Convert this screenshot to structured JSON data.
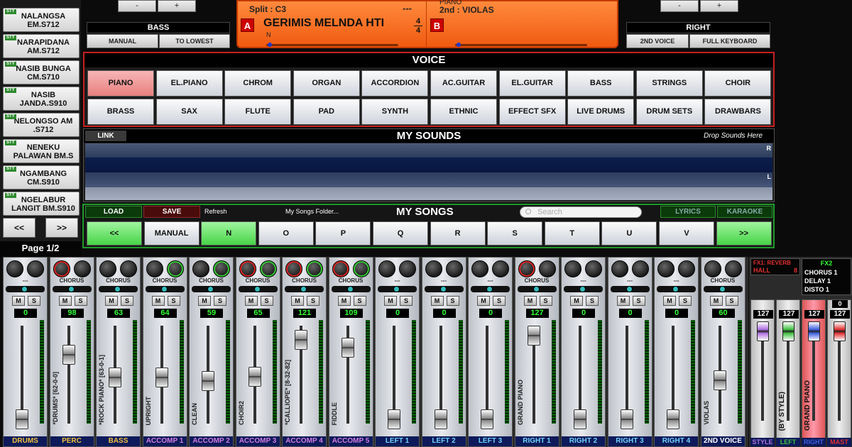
{
  "songs": [
    {
      "badge": "STY",
      "name": "NALANGSA EM.S712"
    },
    {
      "badge": "STY",
      "name": "NARAPIDANA AM.S712"
    },
    {
      "badge": "STY",
      "name": "NASIB BUNGA CM.S710"
    },
    {
      "badge": "STY",
      "name": "NASIB JANDA.S910"
    },
    {
      "badge": "STY",
      "name": "NELONGSO AM .S712"
    },
    {
      "badge": "STY",
      "name": "NENEKU PALAWAN BM.S"
    },
    {
      "badge": "STY",
      "name": "NGAMBANG CM.S910"
    },
    {
      "badge": "STY",
      "name": "NGELABUR LANGIT BM.S910"
    }
  ],
  "song_nav": {
    "prev": "<<",
    "next": ">>"
  },
  "page_label": "Page 1/2",
  "top_left_buttons": [
    "-",
    "+"
  ],
  "top_right_buttons": [
    "-",
    "+"
  ],
  "bass": {
    "title": "BASS",
    "buttons": [
      "MANUAL",
      "TO LOWEST"
    ]
  },
  "right": {
    "title": "RIGHT",
    "buttons": [
      "2ND VOICE",
      "FULL KEYBOARD"
    ]
  },
  "display": {
    "split": "Split : C3",
    "dashes": "---",
    "voice_a_label": "A",
    "song_title": "GERIMIS MELNDA HTI",
    "voice_b_label": "B",
    "time_sig_top": "4",
    "time_sig_bottom": "4",
    "n_label": "N",
    "piano": "PIANO",
    "second": "2nd : VIOLAS"
  },
  "voice": {
    "title": "VOICE",
    "row1": [
      "PIANO",
      "EL.PIANO",
      "CHROM",
      "ORGAN",
      "ACCORDION",
      "AC.GUITAR",
      "EL.GUITAR",
      "BASS",
      "STRINGS",
      "CHOIR"
    ],
    "row2": [
      "BRASS",
      "SAX",
      "FLUTE",
      "PAD",
      "SYNTH",
      "ETHNIC",
      "EFFECT SFX",
      "LIVE DRUMS",
      "DRUM SETS",
      "DRAWBARS"
    ],
    "selected": "PIANO"
  },
  "my_sounds": {
    "link": "LINK",
    "title": "MY SOUNDS",
    "hint": "Drop Sounds Here",
    "r": "R",
    "l": "L"
  },
  "my_songs": {
    "load": "LOAD",
    "save": "SAVE",
    "refresh": "Refresh",
    "folder": "My Songs Folder...",
    "title": "MY SONGS",
    "search_placeholder": "Search",
    "lyrics": "LYRICS",
    "karaoke": "KARAOKE",
    "buttons": [
      "<<",
      "MANUAL",
      "N",
      "O",
      "P",
      "Q",
      "R",
      "S",
      "T",
      "U",
      "V",
      ">>"
    ]
  },
  "channels": [
    {
      "name": "DRUMS",
      "voice": "",
      "fx": "---",
      "vol": "0",
      "level": 0.0,
      "color": "#f0c040",
      "k1": "",
      "k2": ""
    },
    {
      "name": "PERC",
      "voice": "*DRUMS* [62-0-0]",
      "fx": "CHORUS",
      "vol": "98",
      "level": 0.77,
      "color": "#f0c040",
      "k1": "red",
      "k2": ""
    },
    {
      "name": "BASS",
      "voice": "*ROCK PIANO* [63-0-1]",
      "fx": "CHORUS",
      "vol": "63",
      "level": 0.5,
      "color": "#f0c040",
      "k1": "",
      "k2": ""
    },
    {
      "name": "ACCOMP 1",
      "voice": "UPRIGHT",
      "fx": "CHORUS",
      "vol": "64",
      "level": 0.5,
      "color": "#d07be0",
      "k1": "",
      "k2": "grn"
    },
    {
      "name": "ACCOMP 2",
      "voice": "CLEAN",
      "fx": "CHORUS",
      "vol": "59",
      "level": 0.46,
      "color": "#d07be0",
      "k1": "",
      "k2": "grn"
    },
    {
      "name": "ACCOMP 3",
      "voice": "CHOIR2",
      "fx": "CHORUS",
      "vol": "65",
      "level": 0.51,
      "color": "#d07be0",
      "k1": "red",
      "k2": "grn"
    },
    {
      "name": "ACCOMP 4",
      "voice": "*CALLIOPE* [8-32-82]",
      "fx": "CHORUS",
      "vol": "121",
      "level": 0.95,
      "color": "#d07be0",
      "k1": "red",
      "k2": "grn"
    },
    {
      "name": "ACCOMP 5",
      "voice": "FIDDLE",
      "fx": "CHORUS",
      "vol": "109",
      "level": 0.86,
      "color": "#d07be0",
      "k1": "red",
      "k2": "grn"
    },
    {
      "name": "LEFT 1",
      "voice": "",
      "fx": "---",
      "vol": "0",
      "level": 0.0,
      "color": "#6fd0ff",
      "k1": "",
      "k2": ""
    },
    {
      "name": "LEFT 2",
      "voice": "",
      "fx": "---",
      "vol": "0",
      "level": 0.0,
      "color": "#6fd0ff",
      "k1": "",
      "k2": ""
    },
    {
      "name": "LEFT 3",
      "voice": "",
      "fx": "---",
      "vol": "0",
      "level": 0.0,
      "color": "#6fd0ff",
      "k1": "",
      "k2": ""
    },
    {
      "name": "RIGHT 1",
      "voice": "GRAND PIANO",
      "fx": "CHORUS",
      "vol": "127",
      "level": 1.0,
      "color": "#6fd0ff",
      "k1": "red",
      "k2": ""
    },
    {
      "name": "RIGHT 2",
      "voice": "",
      "fx": "---",
      "vol": "0",
      "level": 0.0,
      "color": "#6fd0ff",
      "k1": "",
      "k2": ""
    },
    {
      "name": "RIGHT 3",
      "voice": "",
      "fx": "---",
      "vol": "0",
      "level": 0.0,
      "color": "#6fd0ff",
      "k1": "",
      "k2": ""
    },
    {
      "name": "RIGHT 4",
      "voice": "",
      "fx": "---",
      "vol": "0",
      "level": 0.0,
      "color": "#6fd0ff",
      "k1": "",
      "k2": ""
    },
    {
      "name": "2ND VOICE",
      "voice": "VIOLAS",
      "fx": "CHORUS",
      "vol": "60",
      "level": 0.47,
      "color": "#ffffff",
      "k1": "",
      "k2": ""
    }
  ],
  "fx": {
    "fx1_title": "FX1: REVERB",
    "fx1_value": "HALL",
    "fx1_num": "8",
    "fx2_title": "FX2",
    "fx2_items": [
      "CHORUS 1",
      "DELAY 1",
      "DISTO 1"
    ],
    "columns": [
      {
        "name": "STYLE",
        "vol": "127",
        "label": "",
        "color": "#b070e0"
      },
      {
        "name": "LEFT",
        "vol": "127",
        "label": "(BY STYLE)",
        "color": "#40c040"
      },
      {
        "name": "RIGHT",
        "vol": "127",
        "label": "GRAND PIANO",
        "color": "#4060e0"
      },
      {
        "name": "MAST",
        "vol": "127",
        "label": "",
        "color": "#e03030",
        "extra": "0"
      }
    ]
  }
}
